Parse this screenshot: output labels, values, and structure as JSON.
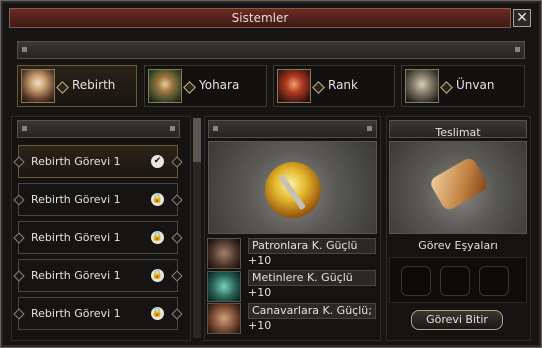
{
  "window": {
    "title": "Sistemler",
    "close_label": "✕"
  },
  "tabs": [
    {
      "label": "Rebirth",
      "active": true
    },
    {
      "label": "Yohara",
      "active": false
    },
    {
      "label": "Rank",
      "active": false
    },
    {
      "label": "Ünvan",
      "active": false
    }
  ],
  "quests": [
    {
      "label": "Rebirth Görevi 1",
      "status_icon": "check-icon",
      "glyph": "✔"
    },
    {
      "label": "Rebirth Görevi 1",
      "status_icon": "lock-icon",
      "glyph": "🔒"
    },
    {
      "label": "Rebirth Görevi 1",
      "status_icon": "lock-icon",
      "glyph": "🔒"
    },
    {
      "label": "Rebirth Görevi 1",
      "status_icon": "lock-icon",
      "glyph": "🔒"
    },
    {
      "label": "Rebirth Görevi 1",
      "status_icon": "lock-icon",
      "glyph": "🔒"
    }
  ],
  "rewards": [
    {
      "name": "Patronlara K. Güçlü",
      "value": "+10"
    },
    {
      "name": "Metinlere K. Güçlü",
      "value": "+10"
    },
    {
      "name": "Canavarlara K. Güçlü;",
      "value": "+10"
    }
  ],
  "delivery": {
    "header": "Teslimat",
    "items_label": "Görev Eşyaları",
    "finish_button": "Görevi Bitir"
  },
  "colors": {
    "accent": "#6b2a22",
    "gold": "#d4a23a"
  }
}
